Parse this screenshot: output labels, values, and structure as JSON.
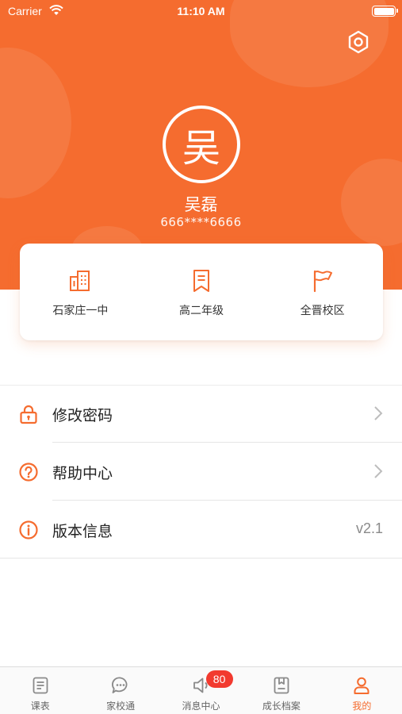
{
  "status_bar": {
    "carrier": "Carrier",
    "time": "11:10 AM"
  },
  "profile": {
    "avatar_text": "吴",
    "name": "吴磊",
    "phone": "666****6666"
  },
  "info_card": [
    {
      "icon": "building-icon",
      "label": "石家庄一中"
    },
    {
      "icon": "bookmark-icon",
      "label": "高二年级"
    },
    {
      "icon": "flag-icon",
      "label": "全晋校区"
    }
  ],
  "menu": [
    {
      "icon": "lock-icon",
      "label": "修改密码"
    },
    {
      "icon": "help-icon",
      "label": "帮助中心"
    },
    {
      "icon": "info-icon",
      "label": "版本信息",
      "value": "v2.1"
    }
  ],
  "tabs": [
    {
      "icon": "schedule-icon",
      "label": "课表"
    },
    {
      "icon": "chat-icon",
      "label": "家校通"
    },
    {
      "icon": "speaker-icon",
      "label": "消息中心",
      "badge": "80"
    },
    {
      "icon": "archive-icon",
      "label": "成长档案"
    },
    {
      "icon": "person-icon",
      "label": "我的",
      "active": true
    }
  ],
  "colors": {
    "accent": "#f56c2f",
    "badge": "#f23a2f"
  }
}
